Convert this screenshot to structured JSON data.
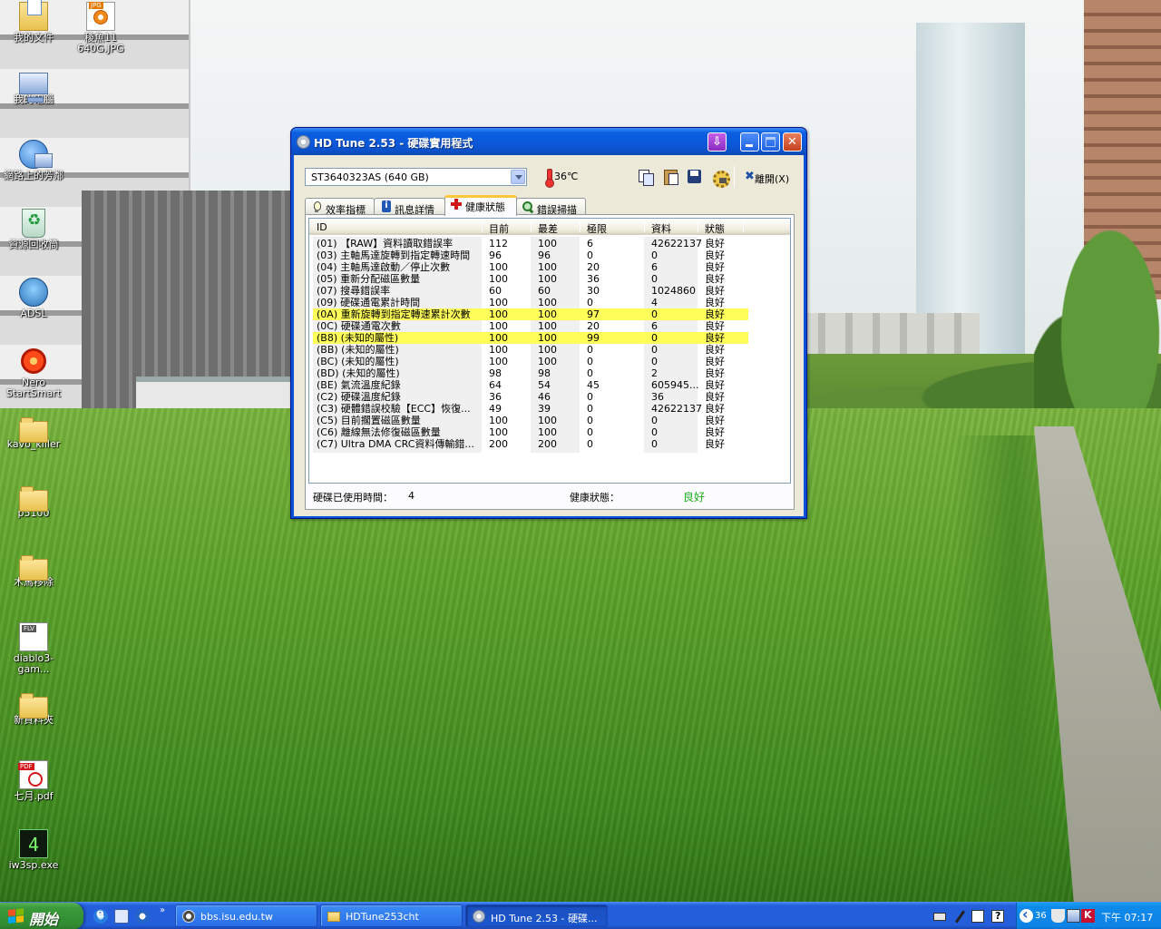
{
  "desktop": {
    "icons": [
      {
        "label": "我的文件",
        "icon": "my-documents-icon"
      },
      {
        "label": "我的電腦",
        "icon": "my-computer-icon"
      },
      {
        "label": "網路上的芳鄰",
        "icon": "network-places-icon"
      },
      {
        "label": "資源回收筒",
        "icon": "recycle-bin-icon"
      },
      {
        "label": "ADSL",
        "icon": "adsl-connection-icon"
      },
      {
        "label": "Nero StartSmart",
        "icon": "nero-icon"
      },
      {
        "label": "kavo_killer",
        "icon": "folder-icon"
      },
      {
        "label": "p5100",
        "icon": "folder-icon"
      },
      {
        "label": "木馬移除",
        "icon": "folder-icon"
      },
      {
        "label": "diablo3-gam...",
        "icon": "flv-file-icon"
      },
      {
        "label": "新資料夾",
        "icon": "folder-icon"
      },
      {
        "label": "七月.pdf",
        "icon": "pdf-file-icon"
      },
      {
        "label": "iw3sp.exe",
        "icon": "exe-file-icon"
      },
      {
        "label": "稜魚11 640G.JPG",
        "icon": "jpg-file-icon"
      }
    ]
  },
  "window": {
    "title": "HD Tune 2.53 - 硬碟實用程式",
    "drive": "ST3640323AS (640 GB)",
    "temperature": "36℃",
    "exit_label": "離開(X)",
    "tabs": [
      {
        "label": "效率指標",
        "icon": "lightbulb-icon"
      },
      {
        "label": "訊息詳情",
        "icon": "info-icon"
      },
      {
        "label": "健康狀態",
        "icon": "health-cross-icon",
        "active": true
      },
      {
        "label": "錯誤掃描",
        "icon": "magnifier-icon"
      }
    ],
    "columns": [
      "ID",
      "目前",
      "最差",
      "極限",
      "資料",
      "狀態"
    ],
    "rows": [
      [
        "(01) 【RAW】資料讀取錯誤率",
        "112",
        "100",
        "6",
        "42622137",
        "良好"
      ],
      [
        "(03) 主軸馬達旋轉到指定轉速時間",
        "96",
        "96",
        "0",
        "0",
        "良好"
      ],
      [
        "(04) 主軸馬達啟動／停止次數",
        "100",
        "100",
        "20",
        "6",
        "良好"
      ],
      [
        "(05) 重新分配磁區數量",
        "100",
        "100",
        "36",
        "0",
        "良好"
      ],
      [
        "(07) 搜尋錯誤率",
        "60",
        "60",
        "30",
        "1024860",
        "良好"
      ],
      [
        "(09) 硬碟通電累計時間",
        "100",
        "100",
        "0",
        "4",
        "良好"
      ],
      [
        "(0A) 重新旋轉到指定轉速累計次數",
        "100",
        "100",
        "97",
        "0",
        "良好"
      ],
      [
        "(0C) 硬碟通電次數",
        "100",
        "100",
        "20",
        "6",
        "良好"
      ],
      [
        "(B8) (未知的屬性)",
        "100",
        "100",
        "99",
        "0",
        "良好"
      ],
      [
        "(BB) (未知的屬性)",
        "100",
        "100",
        "0",
        "0",
        "良好"
      ],
      [
        "(BC) (未知的屬性)",
        "100",
        "100",
        "0",
        "0",
        "良好"
      ],
      [
        "(BD) (未知的屬性)",
        "98",
        "98",
        "0",
        "2",
        "良好"
      ],
      [
        "(BE) 氣流溫度紀錄",
        "64",
        "54",
        "45",
        "605945...",
        "良好"
      ],
      [
        "(C2) 硬碟溫度紀錄",
        "36",
        "46",
        "0",
        "36",
        "良好"
      ],
      [
        "(C3) 硬體錯誤校驗【ECC】恢復...",
        "49",
        "39",
        "0",
        "42622137",
        "良好"
      ],
      [
        "(C5) 目前擱置磁區數量",
        "100",
        "100",
        "0",
        "0",
        "良好"
      ],
      [
        "(C6) 離線無法修復磁區數量",
        "100",
        "100",
        "0",
        "0",
        "良好"
      ],
      [
        "(C7) Ultra DMA CRC資料傳輸錯...",
        "200",
        "200",
        "0",
        "0",
        "良好"
      ]
    ],
    "highlighted_rows": [
      6,
      8
    ],
    "status": {
      "power_on_label": "硬碟已使用時間：",
      "power_on_value": "4",
      "health_label": "健康狀態：",
      "health_value": "良好"
    }
  },
  "taskbar": {
    "start_label": "開始",
    "tasks": [
      {
        "label": "bbs.isu.edu.tw",
        "icon": "browser-icon"
      },
      {
        "label": "HDTune253cht",
        "icon": "folder-icon"
      },
      {
        "label": "HD Tune 2.53 - 硬碟...",
        "icon": "hdtune-icon",
        "active": true
      }
    ],
    "tray_number": "36",
    "clock": "下午 07:17"
  },
  "colors": {
    "highlight": "#ffff5a",
    "health_good": "#1fae1f",
    "title_bar": "#0a5fe0",
    "taskbar": "#245edb",
    "start_button": "#3a9a3a"
  }
}
